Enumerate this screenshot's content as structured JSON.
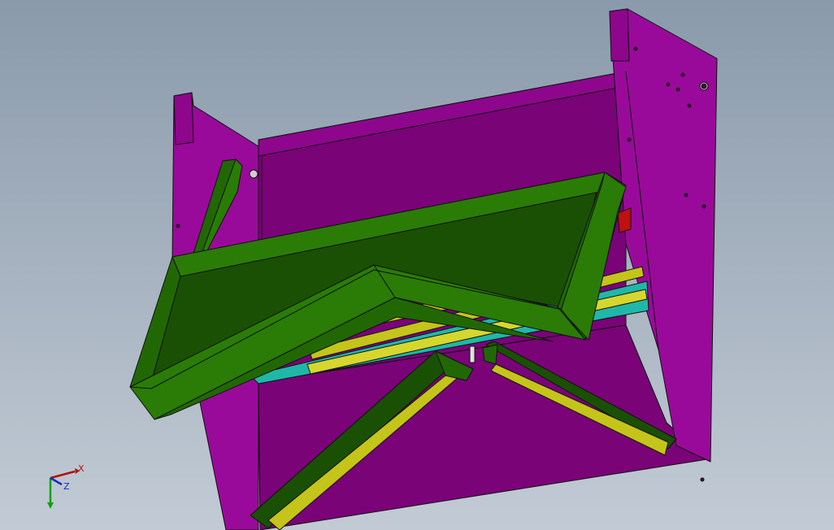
{
  "colors": {
    "frame": "#9a0a9a",
    "frame_dark": "#7a0378",
    "frame_side": "#8e068c",
    "green": "#2a7c06",
    "green_dark": "#1a5003",
    "green_mid": "#216804",
    "yellow": "#c4c41a",
    "yellow_light": "#d6d62e",
    "teal": "#1fb8a8",
    "outline": "#101010",
    "axis_x": "#b01010",
    "axis_y": "#10a010",
    "axis_z": "#1030c0"
  },
  "triad": {
    "x_label": "X",
    "z_label": "Z"
  }
}
